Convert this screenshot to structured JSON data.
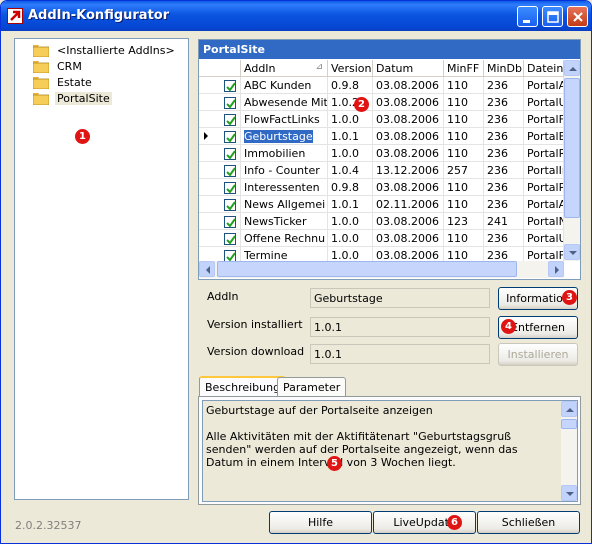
{
  "window": {
    "title": "AddIn-Konfigurator"
  },
  "colors": {
    "accent": "#316ac5",
    "marker": "#e11414",
    "titlebar": "#0b55e0"
  },
  "tree": {
    "items": [
      {
        "label": "<Installierte AddIns>",
        "icon": "folder-icon",
        "selected": false
      },
      {
        "label": "CRM",
        "icon": "folder-icon",
        "selected": false
      },
      {
        "label": "Estate",
        "icon": "folder-icon",
        "selected": false
      },
      {
        "label": "PortalSite",
        "icon": "folder-icon",
        "selected": true
      }
    ]
  },
  "grid": {
    "caption": "PortalSite",
    "columns": [
      "AddIn",
      "Version",
      "Datum",
      "MinFF",
      "MinDb",
      "Dateiname"
    ],
    "sort_indicator": "⊿",
    "rows": [
      {
        "checked": true,
        "addin": "ABC Kunden",
        "version": "0.9.8",
        "datum": "03.08.2006",
        "minff": "110",
        "mindb": "236",
        "datei": "PortalAI"
      },
      {
        "checked": true,
        "addin": "Abwesende Mit",
        "version": "1.0.2",
        "datum": "03.08.2006",
        "minff": "110",
        "mindb": "236",
        "datei": "PortalU"
      },
      {
        "checked": true,
        "addin": "FlowFactLinks",
        "version": "1.0.0",
        "datum": "03.08.2006",
        "minff": "110",
        "mindb": "236",
        "datei": "PortalFl"
      },
      {
        "checked": true,
        "addin": "Geburtstage",
        "version": "1.0.1",
        "datum": "03.08.2006",
        "minff": "110",
        "mindb": "236",
        "datei": "PortalBi",
        "selected": true
      },
      {
        "checked": true,
        "addin": "Immobilien",
        "version": "1.0.0",
        "datum": "03.08.2006",
        "minff": "110",
        "mindb": "236",
        "datei": "PortalR"
      },
      {
        "checked": true,
        "addin": "Info - Counter",
        "version": "1.0.4",
        "datum": "13.12.2006",
        "minff": "257",
        "mindb": "236",
        "datei": "PortalIn"
      },
      {
        "checked": true,
        "addin": "Interessenten",
        "version": "0.9.8",
        "datum": "03.08.2006",
        "minff": "110",
        "mindb": "236",
        "datei": "PortalPi"
      },
      {
        "checked": true,
        "addin": "News Allgemei",
        "version": "1.0.1",
        "datum": "02.11.2006",
        "minff": "110",
        "mindb": "236",
        "datei": "PortalAl"
      },
      {
        "checked": true,
        "addin": "NewsTicker",
        "version": "1.0.0",
        "datum": "03.08.2006",
        "minff": "123",
        "mindb": "241",
        "datei": "PortalN"
      },
      {
        "checked": true,
        "addin": "Offene Rechnu",
        "version": "1.0.0",
        "datum": "03.08.2006",
        "minff": "110",
        "mindb": "236",
        "datei": "PortalU"
      },
      {
        "checked": true,
        "addin": "Termine",
        "version": "1.0.0",
        "datum": "03.08.2006",
        "minff": "110",
        "mindb": "236",
        "datei": "PortalFr"
      }
    ]
  },
  "details": {
    "addin_label": "AddIn",
    "addin_value": "Geburtstage",
    "version_installed_label": "Version installiert",
    "version_installed_value": "1.0.1",
    "version_download_label": "Version download",
    "version_download_value": "1.0.1",
    "information_button": "Information",
    "remove_button": "Entfernen",
    "install_button": "Installieren"
  },
  "tabs": {
    "description": "Beschreibung",
    "parameter": "Parameter"
  },
  "description_text": "Geburtstage auf der Portalseite anzeigen\n\nAlle Aktivitäten mit der Aktifitätenart \"Geburtstagsgruß senden\" werden auf der Portalseite angezeigt, wenn das Datum in einem Intervall von 3 Wochen liegt.",
  "footer": {
    "version": "2.0.2.32537",
    "help_button": "Hilfe",
    "liveupdate_button": "LiveUpdate",
    "close_button": "Schließen"
  },
  "markers": [
    "1",
    "2",
    "3",
    "4",
    "5",
    "6"
  ]
}
